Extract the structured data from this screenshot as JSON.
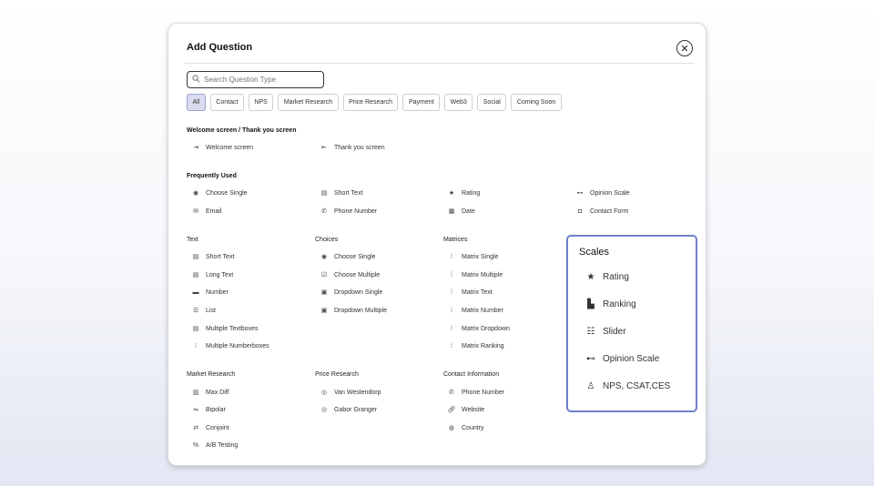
{
  "modal": {
    "title": "Add Question",
    "close": "✕"
  },
  "search": {
    "placeholder": "Search Question Type",
    "icon": "search-icon"
  },
  "chips": [
    "All",
    "Contact",
    "NPS",
    "Market Research",
    "Price Research",
    "Payment",
    "Web3",
    "Social",
    "Coming Soon"
  ],
  "active_chip": "All",
  "sections": {
    "welcome": {
      "title": "Welcome screen / Thank you screen",
      "items": [
        "Welcome screen",
        "Thank you screen"
      ]
    },
    "frequent": {
      "title": "Frequently Used",
      "items": [
        "Choose Single",
        "Short Text",
        "Rating",
        "Opinion Scale",
        "Email",
        "Phone Number",
        "Date",
        "Contact Form"
      ]
    },
    "text": {
      "title": "Text",
      "items": [
        "Short Text",
        "Long Text",
        "Number",
        "List",
        "Multiple Textboxes",
        "Multiple Numberboxes"
      ]
    },
    "choices": {
      "title": "Choices",
      "items": [
        "Choose Single",
        "Choose Multiple",
        "Dropdown Single",
        "Dropdown Multiple"
      ]
    },
    "matrices": {
      "title": "Matrices",
      "items": [
        "Matrix Single",
        "Matrix Multiple",
        "Matrix Text",
        "Matrix Number",
        "Matrix Dropdown",
        "Matrix Ranking"
      ]
    },
    "market": {
      "title": "Market Research",
      "items": [
        "Max Diff",
        "Bipolar",
        "Conjoint",
        "A/B Testing"
      ]
    },
    "price": {
      "title": "Price Research",
      "items": [
        "Van Westendorp",
        "Gabor Granger"
      ]
    },
    "contact": {
      "title": "Contact Information",
      "items": [
        "Phone Number",
        "Website",
        "Country"
      ]
    },
    "scales": {
      "title": "Scales",
      "items": [
        "Rating",
        "Ranking",
        "Slider",
        "Opinion Scale",
        "NPS, CSAT,CES"
      ]
    }
  },
  "colors": {
    "accent": "#6d7fc9",
    "active_chip_bg": "#d9dcf0"
  }
}
